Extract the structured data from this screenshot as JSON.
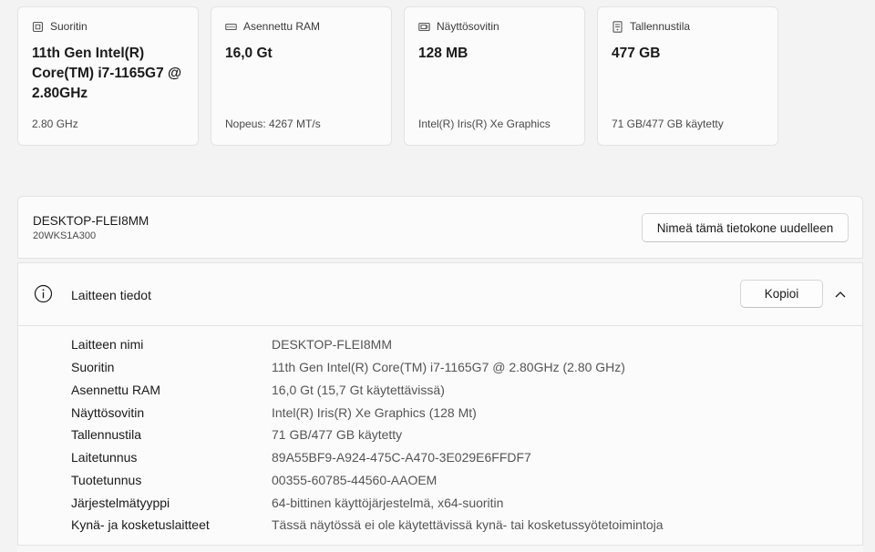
{
  "specs": [
    {
      "icon": "processor-icon",
      "title": "Suoritin",
      "value": "11th Gen Intel(R) Core(TM) i7-1165G7 @ 2.80GHz",
      "sub": "2.80 GHz"
    },
    {
      "icon": "ram-icon",
      "title": "Asennettu RAM",
      "value": "16,0 Gt",
      "sub": "Nopeus: 4267 MT/s"
    },
    {
      "icon": "display-adapter-icon",
      "title": "Näyttösovitin",
      "value": "128 MB",
      "sub": "Intel(R) Iris(R) Xe Graphics"
    },
    {
      "icon": "storage-icon",
      "title": "Tallennustila",
      "value": "477 GB",
      "sub": "71 GB/477 GB käytetty"
    }
  ],
  "device": {
    "name": "DESKTOP-FLEI8MM",
    "model": "20WKS1A300",
    "rename_label": "Nimeä tämä tietokone uudelleen"
  },
  "info": {
    "title": "Laitteen tiedot",
    "copy_label": "Kopioi",
    "rows": [
      {
        "label": "Laitteen nimi",
        "value": "DESKTOP-FLEI8MM"
      },
      {
        "label": "Suoritin",
        "value": "11th Gen Intel(R) Core(TM) i7-1165G7 @ 2.80GHz (2.80 GHz)"
      },
      {
        "label": "Asennettu RAM",
        "value": "16,0 Gt (15,7 Gt käytettävissä)"
      },
      {
        "label": "Näyttösovitin",
        "value": "Intel(R) Iris(R) Xe Graphics (128 Mt)"
      },
      {
        "label": "Tallennustila",
        "value": "71 GB/477 GB käytetty"
      },
      {
        "label": "Laitetunnus",
        "value": "89A55BF9-A924-475C-A470-3E029E6FFDF7"
      },
      {
        "label": "Tuotetunnus",
        "value": "00355-60785-44560-AAOEM"
      },
      {
        "label": "Järjestelmätyyppi",
        "value": "64-bittinen käyttöjärjestelmä, x64-suoritin"
      },
      {
        "label": "Kynä- ja kosketuslaitteet",
        "value": "Tässä näytössä ei ole käytettävissä kynä- tai kosketussyötetoimintoja"
      }
    ]
  }
}
